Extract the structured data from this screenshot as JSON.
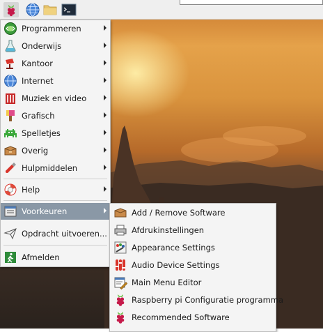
{
  "menu": {
    "items": [
      {
        "label": "Programmeren",
        "icon": "programming-icon"
      },
      {
        "label": "Onderwijs",
        "icon": "education-icon"
      },
      {
        "label": "Kantoor",
        "icon": "office-icon"
      },
      {
        "label": "Internet",
        "icon": "internet-icon"
      },
      {
        "label": "Muziek en video",
        "icon": "multimedia-icon"
      },
      {
        "label": "Grafisch",
        "icon": "graphics-icon"
      },
      {
        "label": "Spelletjes",
        "icon": "games-icon"
      },
      {
        "label": "Overig",
        "icon": "other-icon"
      },
      {
        "label": "Hulpmiddelen",
        "icon": "accessories-icon"
      }
    ],
    "help_label": "Help",
    "preferences_label": "Voorkeuren",
    "run_label": "Opdracht uitvoeren...",
    "logout_label": "Afmelden"
  },
  "submenu": {
    "items": [
      {
        "label": "Add / Remove Software",
        "icon": "package-icon"
      },
      {
        "label": "Afdrukinstellingen",
        "icon": "printer-icon"
      },
      {
        "label": "Appearance Settings",
        "icon": "appearance-icon"
      },
      {
        "label": "Audio Device Settings",
        "icon": "audio-mixer-icon"
      },
      {
        "label": "Main Menu Editor",
        "icon": "menu-editor-icon"
      },
      {
        "label": "Raspberry pi Configuratie programma",
        "icon": "raspberry-icon"
      },
      {
        "label": "Recommended Software",
        "icon": "raspberry-icon"
      }
    ]
  },
  "colors": {
    "selection": "#8a98a6",
    "menu_bg": "#f4f4f4",
    "raspberry_red": "#c51a4a",
    "raspberry_green": "#6cc04a"
  }
}
